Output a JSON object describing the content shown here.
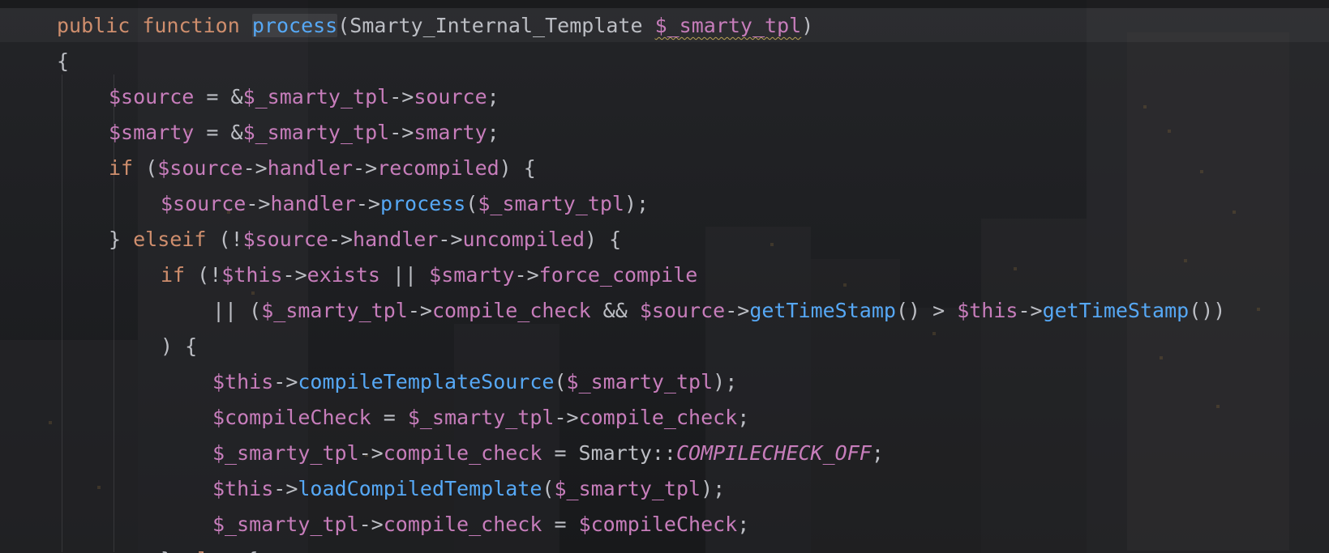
{
  "editor": {
    "language": "PHP",
    "theme_colors": {
      "keyword": "#cf8e6d",
      "variable": "#c77dbb",
      "method_call": "#56a8f5",
      "plain": "#bcbec4",
      "background": "#1e1f22"
    },
    "lines": [
      {
        "indent": 1,
        "tokens": [
          {
            "t": "public",
            "c": "kw"
          },
          {
            "t": " ",
            "c": "plain"
          },
          {
            "t": "function",
            "c": "kw"
          },
          {
            "t": " ",
            "c": "plain"
          },
          {
            "t": "process",
            "c": "call",
            "x": "hl-name"
          },
          {
            "t": "(Smarty_Internal_Template ",
            "c": "plain"
          },
          {
            "t": "$_smarty_tpl",
            "c": "var",
            "x": "squiggle"
          },
          {
            "t": ")",
            "c": "plain"
          }
        ]
      },
      {
        "indent": 1,
        "tokens": [
          {
            "t": "{",
            "c": "plain"
          }
        ]
      },
      {
        "indent": 2,
        "tokens": [
          {
            "t": "$source",
            "c": "var"
          },
          {
            "t": " = &",
            "c": "plain"
          },
          {
            "t": "$_smarty_tpl",
            "c": "var"
          },
          {
            "t": "->",
            "c": "plain"
          },
          {
            "t": "source",
            "c": "var"
          },
          {
            "t": ";",
            "c": "plain"
          }
        ]
      },
      {
        "indent": 2,
        "tokens": [
          {
            "t": "$smarty",
            "c": "var"
          },
          {
            "t": " = &",
            "c": "plain"
          },
          {
            "t": "$_smarty_tpl",
            "c": "var"
          },
          {
            "t": "->",
            "c": "plain"
          },
          {
            "t": "smarty",
            "c": "var"
          },
          {
            "t": ";",
            "c": "plain"
          }
        ]
      },
      {
        "indent": 2,
        "tokens": [
          {
            "t": "if",
            "c": "kw"
          },
          {
            "t": " (",
            "c": "plain"
          },
          {
            "t": "$source",
            "c": "var"
          },
          {
            "t": "->",
            "c": "plain"
          },
          {
            "t": "handler",
            "c": "var"
          },
          {
            "t": "->",
            "c": "plain"
          },
          {
            "t": "recompiled",
            "c": "var"
          },
          {
            "t": ") {",
            "c": "plain"
          }
        ]
      },
      {
        "indent": 3,
        "tokens": [
          {
            "t": "$source",
            "c": "var"
          },
          {
            "t": "->",
            "c": "plain"
          },
          {
            "t": "handler",
            "c": "var"
          },
          {
            "t": "->",
            "c": "plain"
          },
          {
            "t": "process",
            "c": "call"
          },
          {
            "t": "(",
            "c": "plain"
          },
          {
            "t": "$_smarty_tpl",
            "c": "var"
          },
          {
            "t": ");",
            "c": "plain"
          }
        ]
      },
      {
        "indent": 2,
        "tokens": [
          {
            "t": "} ",
            "c": "plain"
          },
          {
            "t": "elseif",
            "c": "kw"
          },
          {
            "t": " (!",
            "c": "plain"
          },
          {
            "t": "$source",
            "c": "var"
          },
          {
            "t": "->",
            "c": "plain"
          },
          {
            "t": "handler",
            "c": "var"
          },
          {
            "t": "->",
            "c": "plain"
          },
          {
            "t": "uncompiled",
            "c": "var"
          },
          {
            "t": ") {",
            "c": "plain"
          }
        ]
      },
      {
        "indent": 3,
        "tokens": [
          {
            "t": "if",
            "c": "kw"
          },
          {
            "t": " (!",
            "c": "plain"
          },
          {
            "t": "$this",
            "c": "var"
          },
          {
            "t": "->",
            "c": "plain"
          },
          {
            "t": "exists",
            "c": "var"
          },
          {
            "t": " || ",
            "c": "plain"
          },
          {
            "t": "$smarty",
            "c": "var"
          },
          {
            "t": "->",
            "c": "plain"
          },
          {
            "t": "force_compile",
            "c": "var"
          }
        ]
      },
      {
        "indent": 4,
        "tokens": [
          {
            "t": "|| (",
            "c": "plain"
          },
          {
            "t": "$_smarty_tpl",
            "c": "var"
          },
          {
            "t": "->",
            "c": "plain"
          },
          {
            "t": "compile_check",
            "c": "var"
          },
          {
            "t": " && ",
            "c": "plain"
          },
          {
            "t": "$source",
            "c": "var"
          },
          {
            "t": "->",
            "c": "plain"
          },
          {
            "t": "getTimeStamp",
            "c": "call"
          },
          {
            "t": "() > ",
            "c": "plain"
          },
          {
            "t": "$this",
            "c": "var"
          },
          {
            "t": "->",
            "c": "plain"
          },
          {
            "t": "getTimeStamp",
            "c": "call"
          },
          {
            "t": "())",
            "c": "plain"
          }
        ]
      },
      {
        "indent": 3,
        "tokens": [
          {
            "t": ") {",
            "c": "plain"
          }
        ]
      },
      {
        "indent": 4,
        "tokens": [
          {
            "t": "$this",
            "c": "var"
          },
          {
            "t": "->",
            "c": "plain"
          },
          {
            "t": "compileTemplateSource",
            "c": "call"
          },
          {
            "t": "(",
            "c": "plain"
          },
          {
            "t": "$_smarty_tpl",
            "c": "var"
          },
          {
            "t": ");",
            "c": "plain"
          }
        ]
      },
      {
        "indent": 4,
        "tokens": [
          {
            "t": "$compileCheck",
            "c": "var"
          },
          {
            "t": " = ",
            "c": "plain"
          },
          {
            "t": "$_smarty_tpl",
            "c": "var"
          },
          {
            "t": "->",
            "c": "plain"
          },
          {
            "t": "compile_check",
            "c": "var"
          },
          {
            "t": ";",
            "c": "plain"
          }
        ]
      },
      {
        "indent": 4,
        "tokens": [
          {
            "t": "$_smarty_tpl",
            "c": "var"
          },
          {
            "t": "->",
            "c": "plain"
          },
          {
            "t": "compile_check",
            "c": "var"
          },
          {
            "t": " = Smarty::",
            "c": "plain"
          },
          {
            "t": "COMPILECHECK_OFF",
            "c": "const"
          },
          {
            "t": ";",
            "c": "plain"
          }
        ]
      },
      {
        "indent": 4,
        "tokens": [
          {
            "t": "$this",
            "c": "var"
          },
          {
            "t": "->",
            "c": "plain"
          },
          {
            "t": "loadCompiledTemplate",
            "c": "call"
          },
          {
            "t": "(",
            "c": "plain"
          },
          {
            "t": "$_smarty_tpl",
            "c": "var"
          },
          {
            "t": ");",
            "c": "plain"
          }
        ]
      },
      {
        "indent": 4,
        "tokens": [
          {
            "t": "$_smarty_tpl",
            "c": "var"
          },
          {
            "t": "->",
            "c": "plain"
          },
          {
            "t": "compile_check",
            "c": "var"
          },
          {
            "t": " = ",
            "c": "plain"
          },
          {
            "t": "$compileCheck",
            "c": "var"
          },
          {
            "t": ";",
            "c": "plain"
          }
        ]
      },
      {
        "indent": 3,
        "tokens": [
          {
            "t": "} ",
            "c": "plain"
          },
          {
            "t": "else",
            "c": "kw"
          },
          {
            "t": " {",
            "c": "plain"
          }
        ]
      }
    ]
  }
}
